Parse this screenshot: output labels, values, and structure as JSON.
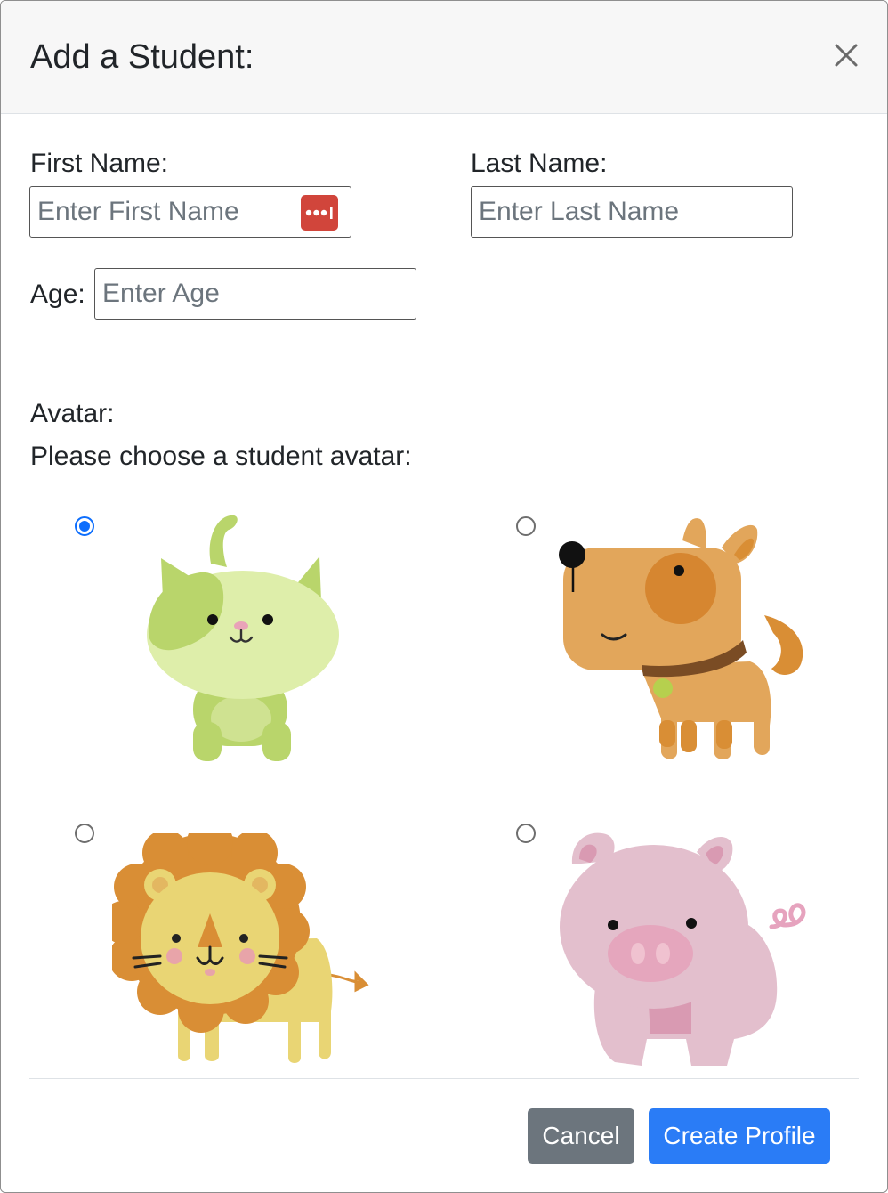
{
  "modal": {
    "title": "Add a Student:",
    "close_icon": "close-icon"
  },
  "form": {
    "first_name": {
      "label": "First Name:",
      "placeholder": "Enter First Name",
      "value": ""
    },
    "last_name": {
      "label": "Last Name:",
      "placeholder": "Enter Last Name",
      "value": ""
    },
    "age": {
      "label": "Age:",
      "placeholder": "Enter Age",
      "value": ""
    },
    "password_manager_icon": "password-manager-icon"
  },
  "avatar": {
    "label": "Avatar:",
    "prompt": "Please choose a student avatar:",
    "options": [
      {
        "name": "cat",
        "selected": true
      },
      {
        "name": "dog",
        "selected": false
      },
      {
        "name": "lion",
        "selected": false
      },
      {
        "name": "pig",
        "selected": false
      }
    ]
  },
  "footer": {
    "cancel_label": "Cancel",
    "create_label": "Create Profile"
  },
  "colors": {
    "primary": "#2a7cf6",
    "secondary": "#6c757d",
    "radio_checked": "#0d6efd",
    "password_icon": "#d1453b"
  }
}
